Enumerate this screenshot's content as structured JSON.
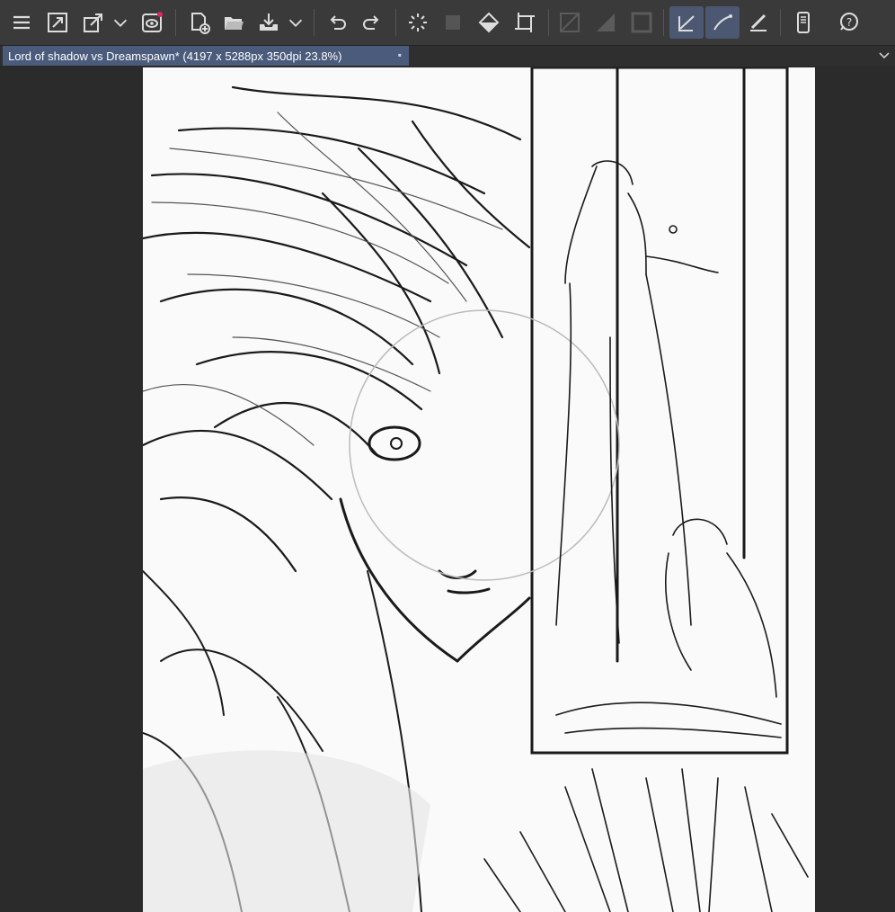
{
  "toolbar": {
    "buttons": [
      {
        "name": "menu-icon"
      },
      {
        "name": "fit-window-icon"
      },
      {
        "name": "transform-icon"
      },
      {
        "name": "dropdown-chevron-icon"
      },
      {
        "name": "companion-icon"
      },
      {
        "name": "new-canvas-icon"
      },
      {
        "name": "open-folder-icon"
      },
      {
        "name": "save-icon"
      },
      {
        "name": "save-dropdown-chevron-icon"
      },
      {
        "name": "undo-icon"
      },
      {
        "name": "redo-icon"
      },
      {
        "name": "loading-spinner-icon"
      },
      {
        "name": "clear-icon"
      },
      {
        "name": "fill-icon"
      },
      {
        "name": "crop-icon"
      },
      {
        "name": "ruler-disabled-icon"
      },
      {
        "name": "gradient-disabled-icon"
      },
      {
        "name": "frame-disabled-icon"
      },
      {
        "name": "stabilizer-icon"
      },
      {
        "name": "vector-snap-icon"
      },
      {
        "name": "pen-pressure-icon"
      },
      {
        "name": "device-icon"
      },
      {
        "name": "help-icon"
      }
    ]
  },
  "document": {
    "tab_title": "Lord of shadow vs Dreamspawn* (4197 x 5288px 350dpi 23.8%)",
    "close_symbol": "▪"
  },
  "colors": {
    "toolbar_bg": "#3a3a3a",
    "tab_active": "#4a5b7c",
    "active_tool": "#4c5872",
    "workspace": "#2b2b2b",
    "canvas": "#fafafa",
    "ink": "#1a1a1a"
  }
}
